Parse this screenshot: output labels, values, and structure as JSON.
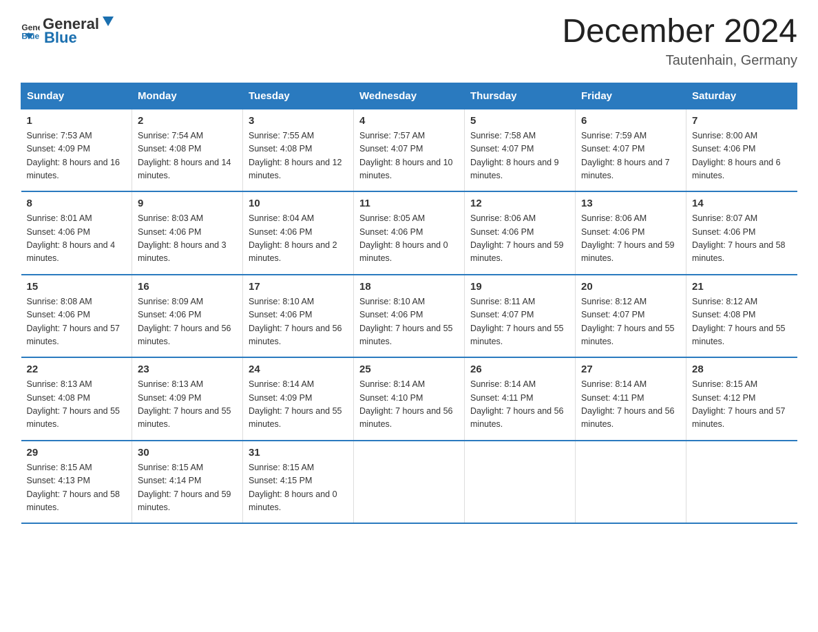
{
  "header": {
    "logo_general": "General",
    "logo_blue": "Blue",
    "month_title": "December 2024",
    "location": "Tautenhain, Germany"
  },
  "days_of_week": [
    "Sunday",
    "Monday",
    "Tuesday",
    "Wednesday",
    "Thursday",
    "Friday",
    "Saturday"
  ],
  "weeks": [
    [
      {
        "day": "1",
        "sunrise": "7:53 AM",
        "sunset": "4:09 PM",
        "daylight": "8 hours and 16 minutes."
      },
      {
        "day": "2",
        "sunrise": "7:54 AM",
        "sunset": "4:08 PM",
        "daylight": "8 hours and 14 minutes."
      },
      {
        "day": "3",
        "sunrise": "7:55 AM",
        "sunset": "4:08 PM",
        "daylight": "8 hours and 12 minutes."
      },
      {
        "day": "4",
        "sunrise": "7:57 AM",
        "sunset": "4:07 PM",
        "daylight": "8 hours and 10 minutes."
      },
      {
        "day": "5",
        "sunrise": "7:58 AM",
        "sunset": "4:07 PM",
        "daylight": "8 hours and 9 minutes."
      },
      {
        "day": "6",
        "sunrise": "7:59 AM",
        "sunset": "4:07 PM",
        "daylight": "8 hours and 7 minutes."
      },
      {
        "day": "7",
        "sunrise": "8:00 AM",
        "sunset": "4:06 PM",
        "daylight": "8 hours and 6 minutes."
      }
    ],
    [
      {
        "day": "8",
        "sunrise": "8:01 AM",
        "sunset": "4:06 PM",
        "daylight": "8 hours and 4 minutes."
      },
      {
        "day": "9",
        "sunrise": "8:03 AM",
        "sunset": "4:06 PM",
        "daylight": "8 hours and 3 minutes."
      },
      {
        "day": "10",
        "sunrise": "8:04 AM",
        "sunset": "4:06 PM",
        "daylight": "8 hours and 2 minutes."
      },
      {
        "day": "11",
        "sunrise": "8:05 AM",
        "sunset": "4:06 PM",
        "daylight": "8 hours and 0 minutes."
      },
      {
        "day": "12",
        "sunrise": "8:06 AM",
        "sunset": "4:06 PM",
        "daylight": "7 hours and 59 minutes."
      },
      {
        "day": "13",
        "sunrise": "8:06 AM",
        "sunset": "4:06 PM",
        "daylight": "7 hours and 59 minutes."
      },
      {
        "day": "14",
        "sunrise": "8:07 AM",
        "sunset": "4:06 PM",
        "daylight": "7 hours and 58 minutes."
      }
    ],
    [
      {
        "day": "15",
        "sunrise": "8:08 AM",
        "sunset": "4:06 PM",
        "daylight": "7 hours and 57 minutes."
      },
      {
        "day": "16",
        "sunrise": "8:09 AM",
        "sunset": "4:06 PM",
        "daylight": "7 hours and 56 minutes."
      },
      {
        "day": "17",
        "sunrise": "8:10 AM",
        "sunset": "4:06 PM",
        "daylight": "7 hours and 56 minutes."
      },
      {
        "day": "18",
        "sunrise": "8:10 AM",
        "sunset": "4:06 PM",
        "daylight": "7 hours and 55 minutes."
      },
      {
        "day": "19",
        "sunrise": "8:11 AM",
        "sunset": "4:07 PM",
        "daylight": "7 hours and 55 minutes."
      },
      {
        "day": "20",
        "sunrise": "8:12 AM",
        "sunset": "4:07 PM",
        "daylight": "7 hours and 55 minutes."
      },
      {
        "day": "21",
        "sunrise": "8:12 AM",
        "sunset": "4:08 PM",
        "daylight": "7 hours and 55 minutes."
      }
    ],
    [
      {
        "day": "22",
        "sunrise": "8:13 AM",
        "sunset": "4:08 PM",
        "daylight": "7 hours and 55 minutes."
      },
      {
        "day": "23",
        "sunrise": "8:13 AM",
        "sunset": "4:09 PM",
        "daylight": "7 hours and 55 minutes."
      },
      {
        "day": "24",
        "sunrise": "8:14 AM",
        "sunset": "4:09 PM",
        "daylight": "7 hours and 55 minutes."
      },
      {
        "day": "25",
        "sunrise": "8:14 AM",
        "sunset": "4:10 PM",
        "daylight": "7 hours and 56 minutes."
      },
      {
        "day": "26",
        "sunrise": "8:14 AM",
        "sunset": "4:11 PM",
        "daylight": "7 hours and 56 minutes."
      },
      {
        "day": "27",
        "sunrise": "8:14 AM",
        "sunset": "4:11 PM",
        "daylight": "7 hours and 56 minutes."
      },
      {
        "day": "28",
        "sunrise": "8:15 AM",
        "sunset": "4:12 PM",
        "daylight": "7 hours and 57 minutes."
      }
    ],
    [
      {
        "day": "29",
        "sunrise": "8:15 AM",
        "sunset": "4:13 PM",
        "daylight": "7 hours and 58 minutes."
      },
      {
        "day": "30",
        "sunrise": "8:15 AM",
        "sunset": "4:14 PM",
        "daylight": "7 hours and 59 minutes."
      },
      {
        "day": "31",
        "sunrise": "8:15 AM",
        "sunset": "4:15 PM",
        "daylight": "8 hours and 0 minutes."
      },
      null,
      null,
      null,
      null
    ]
  ]
}
